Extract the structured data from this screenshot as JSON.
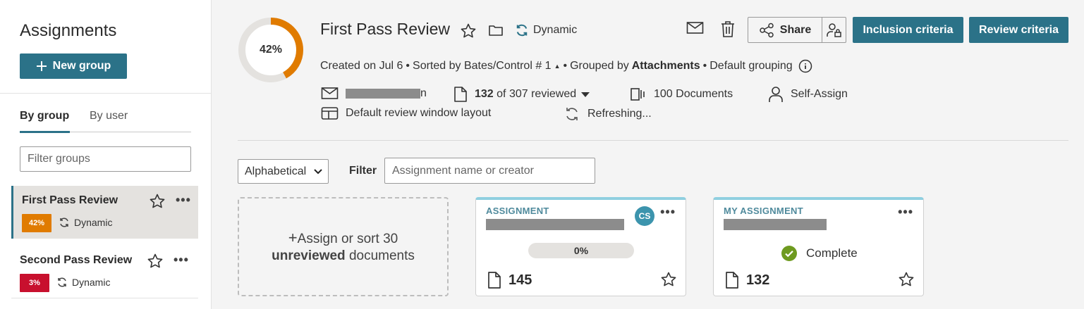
{
  "sidebar": {
    "title": "Assignments",
    "new_group_label": "New group",
    "tabs": [
      {
        "label": "By group",
        "active": true
      },
      {
        "label": "By user",
        "active": false
      }
    ],
    "filter_placeholder": "Filter groups",
    "groups": [
      {
        "name": "First Pass Review",
        "percent": "42%",
        "badge_color": "#e07b00",
        "mode": "Dynamic",
        "selected": true
      },
      {
        "name": "Second Pass Review",
        "percent": "3%",
        "badge_color": "#c8102e",
        "mode": "Dynamic",
        "selected": false
      }
    ]
  },
  "header": {
    "progress_label": "42%",
    "progress_fraction": 0.42,
    "title": "First Pass Review",
    "mode": "Dynamic",
    "meta": {
      "created": "Created on Jul 6",
      "sorted_prefix": "Sorted by Bates/Control # 1",
      "grouped_prefix": "Grouped by",
      "grouped_value": "Attachments",
      "grouping": "Default grouping"
    },
    "creator_suffix": "n",
    "reviewed_count": "132",
    "reviewed_rest": "of 307 reviewed",
    "documents": "100 Documents",
    "self_assign": "Self-Assign",
    "layout": "Default review window layout",
    "refreshing": "Refreshing...",
    "share_label": "Share",
    "inclusion_label": "Inclusion criteria",
    "review_label": "Review criteria"
  },
  "controls": {
    "sort_value": "Alphabetical",
    "filter_label": "Filter",
    "filter_placeholder": "Assignment name or creator"
  },
  "cards": {
    "assign": {
      "line1_prefix": "Assign or sort 30",
      "line2_bold": "unreviewed",
      "line2_rest": "documents"
    },
    "assignment": {
      "kicker": "ASSIGNMENT",
      "avatar": "CS",
      "progress": "0%",
      "count": "145"
    },
    "my_assignment": {
      "kicker": "MY ASSIGNMENT",
      "status": "Complete",
      "count": "132"
    }
  },
  "colors": {
    "primary": "#2b7288",
    "donut_fill": "#e07b00",
    "donut_track": "#e4e2df",
    "card_top": "#8fcfe0",
    "complete_green": "#6e9a1f"
  }
}
